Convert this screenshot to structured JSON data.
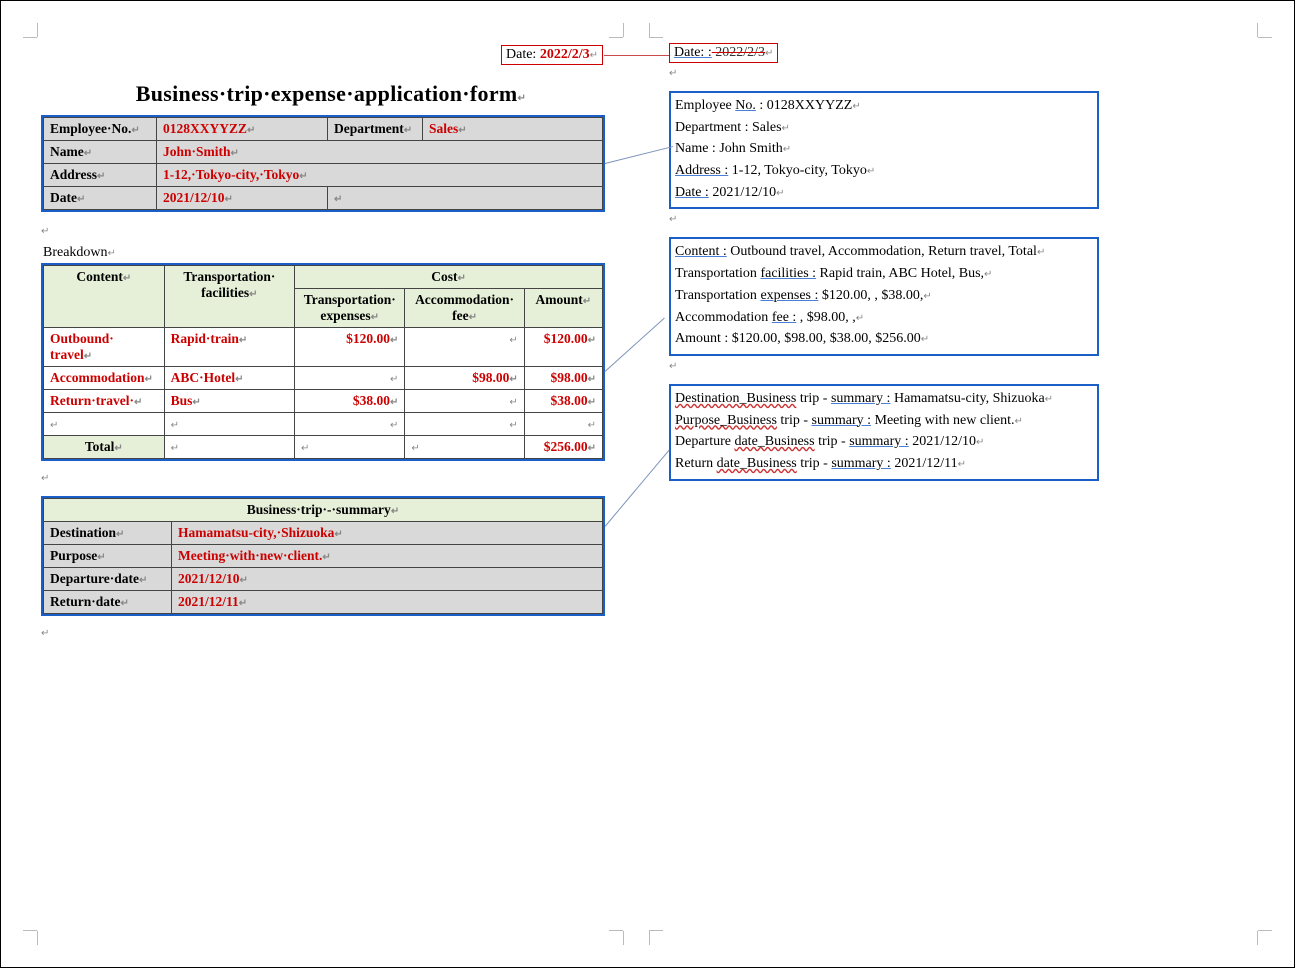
{
  "date_header": {
    "label": "Date: ",
    "value": "2022/2/3",
    "right_label": "Date: :",
    "right_value": " 2022/2/3"
  },
  "title": "Business·trip·expense·application·form",
  "emp_table": {
    "emp_no_label": "Employee·No.",
    "emp_no_value": "0128XXYYZZ",
    "dept_label": "Department",
    "dept_value": "Sales",
    "name_label": "Name",
    "name_value": "John·Smith",
    "address_label": "Address",
    "address_value": "1-12,·Tokyo-city,·Tokyo",
    "date_label": "Date",
    "date_value": "2021/12/10"
  },
  "breakdown_label": "Breakdown",
  "breakdown": {
    "h_content": "Content",
    "h_facilities": "Transportation·\nfacilities",
    "h_cost": "Cost",
    "h_trans_exp": "Transportation·\nexpenses",
    "h_accom_fee": "Accommodation·\nfee",
    "h_amount": "Amount",
    "rows": [
      {
        "content": "Outbound·\ntravel",
        "facility": "Rapid·train",
        "trans": "$120.00",
        "accom": "",
        "amount": "$120.00"
      },
      {
        "content": "Accommodation",
        "facility": "ABC·Hotel",
        "trans": "",
        "accom": "$98.00",
        "amount": "$98.00"
      },
      {
        "content": "Return·travel·",
        "facility": "Bus",
        "trans": "$38.00",
        "accom": "",
        "amount": "$38.00"
      },
      {
        "content": "",
        "facility": "",
        "trans": "",
        "accom": "",
        "amount": ""
      }
    ],
    "total_label": "Total",
    "total_amount": "$256.00"
  },
  "summary": {
    "title": "Business·trip·-·summary",
    "dest_label": "Destination",
    "dest_value": "Hamamatsu-city,·Shizuoka",
    "purpose_label": "Purpose",
    "purpose_value": "Meeting·with·new·client.",
    "dep_label": "Departure·date",
    "dep_value": "2021/12/10",
    "ret_label": "Return·date",
    "ret_value": "2021/12/11"
  },
  "right_panel": {
    "emp": {
      "l1a": "Employee ",
      "l1b": "No.",
      "l1c": " : 0128XXYYZZ",
      "l2": "Department : Sales",
      "l3": "Name : John Smith",
      "l4a": "Address :",
      "l4b": " 1-12, Tokyo-city, Tokyo",
      "l5a": "Date :",
      "l5b": " 2021/12/10"
    },
    "content_box": {
      "l1a": "Content :",
      "l1b": " Outbound travel, Accommodation, Return travel, Total",
      "l2a": "Transportation ",
      "l2b": "facilities :",
      "l2c": " Rapid train, ABC Hotel, Bus,",
      "l3a": "Transportation ",
      "l3b": "expenses :",
      "l3c": " $120.00, , $38.00,",
      "l4a": "Accommodation ",
      "l4b": "fee :",
      "l4c": " , $98.00, ,",
      "l5": "Amount : $120.00, $98.00, $38.00, $256.00"
    },
    "summary_box": {
      "l1a": "Destination_Business",
      "l1b": " trip - ",
      "l1c": "summary :",
      "l1d": " Hamamatsu-city, Shizuoka",
      "l2a": "Purpose_Business",
      "l2b": " trip - ",
      "l2c": "summary :",
      "l2d": " Meeting with new client.",
      "l3a": "Departure ",
      "l3b": "date_Business",
      "l3c": " trip - ",
      "l3d": "summary :",
      "l3e": " 2021/12/10",
      "l4a": "Return ",
      "l4b": "date_Business",
      "l4c": " trip - ",
      "l4d": "summary :",
      "l4e": " 2021/12/11"
    }
  }
}
